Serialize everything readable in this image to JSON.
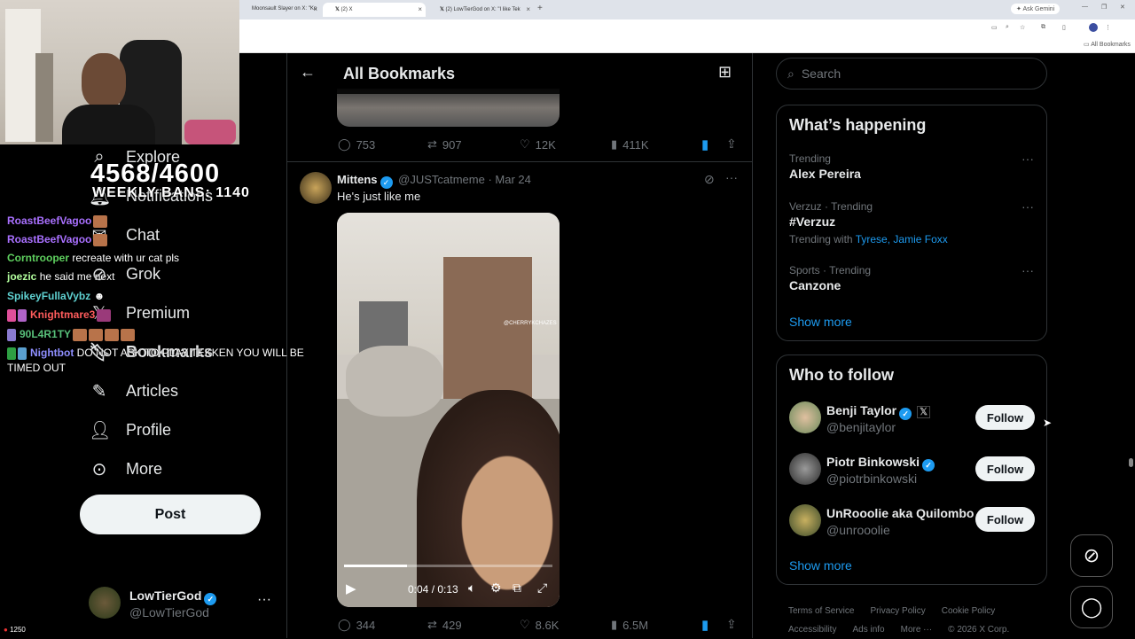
{
  "browser": {
    "tabs": [
      {
        "label": "Moonsault Slayer on X: \"Kn"
      },
      {
        "label": "(2) X",
        "active": true
      },
      {
        "label": "(2) LowTierGod on X: \"I like Tek"
      }
    ],
    "ask_gemini": "Ask Gemini",
    "all_bookmarks": "All Bookmarks"
  },
  "stream": {
    "counter": "4568/4600",
    "subtitle": "WEEKLY BANS: 1140",
    "chat": [
      {
        "user": "RoastBeefVagoo",
        "color": "#a970ff",
        "msg": ""
      },
      {
        "user": "RoastBeefVagoo",
        "color": "#a970ff",
        "msg": ""
      },
      {
        "user": "Corntrooper",
        "color": "#5fd15f",
        "msg": "recreate with ur cat pls"
      },
      {
        "user": "joezic",
        "color": "#b3ff9e",
        "msg": "he said me next"
      },
      {
        "user": "SpikeyFullaVybz",
        "color": "#5fd1d1",
        "msg": ""
      },
      {
        "user": "Knightmare3",
        "color": "#ff5c5c",
        "msg": ""
      },
      {
        "user": "90L4R1TY",
        "color": "#58c07a",
        "msg": ""
      },
      {
        "user": "Nightbot",
        "color": "#8f8fff",
        "msg": "DO NOT ASK TO PLAY TEKKEN YOU WILL BE"
      },
      {
        "user": "",
        "color": "#fff",
        "msg": "TIMED OUT"
      }
    ],
    "viewers": "1250"
  },
  "nav": {
    "items": [
      {
        "label": "Explore",
        "icon": "search-icon"
      },
      {
        "label": "Notifications",
        "icon": "bell-icon"
      },
      {
        "label": "Chat",
        "icon": "mail-icon"
      },
      {
        "label": "Grok",
        "icon": "grok-icon"
      },
      {
        "label": "Premium",
        "icon": "x-icon"
      },
      {
        "label": "Bookmarks",
        "icon": "bookmark-icon"
      },
      {
        "label": "Articles",
        "icon": "article-icon"
      },
      {
        "label": "Profile",
        "icon": "person-icon"
      },
      {
        "label": "More",
        "icon": "more-circle-icon"
      }
    ],
    "post": "Post",
    "account": {
      "name": "LowTierGod",
      "handle": "@LowTierGod"
    }
  },
  "header": {
    "title": "All Bookmarks"
  },
  "tweet1": {
    "replies": "753",
    "reposts": "907",
    "likes": "12K",
    "views": "411K"
  },
  "tweet2": {
    "author": "Mittens",
    "handle": "@JUSTcatmeme",
    "date": "Mar 24",
    "text": "He's just like me",
    "video_time": "0:04 / 0:13",
    "video_progress": 0.3,
    "watermark": "@CHERRYKCHAZES",
    "replies": "344",
    "reposts": "429",
    "likes": "8.6K",
    "views": "6.5M"
  },
  "search": {
    "placeholder": "Search"
  },
  "happening": {
    "title": "What’s happening",
    "trends": [
      {
        "meta": "Trending",
        "name": "Alex Pereira",
        "extra_prefix": "",
        "extra_links": ""
      },
      {
        "meta": "Verzuz · Trending",
        "name": "#Verzuz",
        "extra_prefix": "Trending with",
        "extra_links": "Tyrese, Jamie Foxx"
      },
      {
        "meta": "Sports · Trending",
        "name": "Canzone",
        "extra_prefix": "",
        "extra_links": ""
      }
    ],
    "show_more": "Show more"
  },
  "who_to_follow": {
    "title": "Who to follow",
    "users": [
      {
        "name": "Benji Taylor",
        "handle": "@benjitaylor",
        "button": "Follow"
      },
      {
        "name": "Piotr Binkowski",
        "handle": "@piotrbinkowski",
        "button": "Follow"
      },
      {
        "name": "UnRooolie aka Quilombo",
        "handle": "@unrooolie",
        "button": "Follow"
      }
    ],
    "show_more": "Show more"
  },
  "footer": {
    "links": [
      "Terms of Service",
      "Privacy Policy",
      "Cookie Policy",
      "Accessibility",
      "Ads info",
      "More ···",
      "© 2026 X Corp."
    ]
  },
  "colors": {
    "accent": "#1d9bf0",
    "bg": "#000000",
    "border": "#2f3336",
    "muted": "#71767b"
  }
}
